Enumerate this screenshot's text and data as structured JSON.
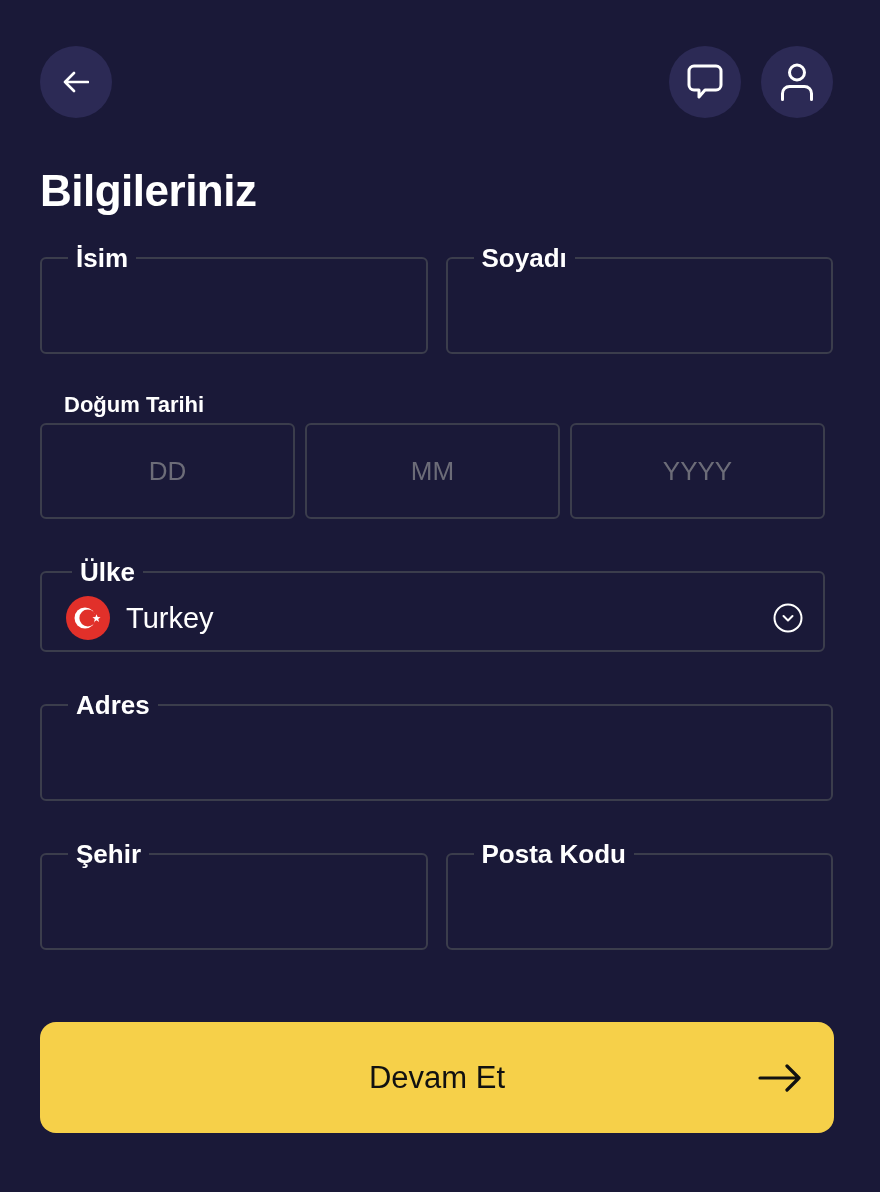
{
  "title": "Bilgileriniz",
  "rows": [
    {
      "kind": "text",
      "fields": [
        {
          "label": "İsim"
        },
        {
          "label": "Soyadı"
        }
      ]
    },
    {
      "kind": "date",
      "label": "Doğum Tarihi",
      "parts": [
        {
          "placeholder": "DD"
        },
        {
          "placeholder": "MM"
        },
        {
          "placeholder": "YYYY"
        }
      ]
    },
    {
      "kind": "select",
      "label": "Ülke",
      "value": "Turkey"
    },
    {
      "kind": "text",
      "fields": [
        {
          "label": "Adres"
        }
      ]
    },
    {
      "kind": "text",
      "fields": [
        {
          "label": "Şehir"
        },
        {
          "label": "Posta Kodu"
        }
      ]
    }
  ],
  "submit": {
    "label": "Devam Et"
  }
}
